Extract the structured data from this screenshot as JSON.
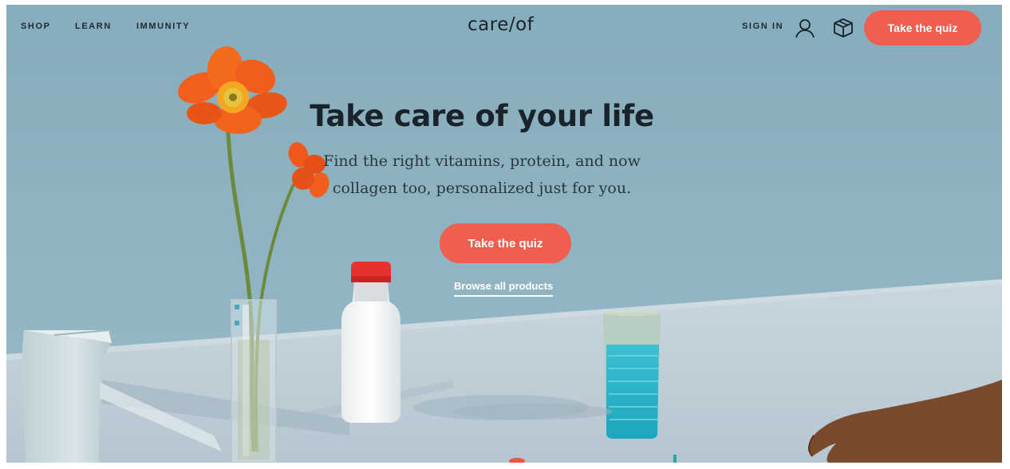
{
  "nav": {
    "links": [
      {
        "label": "SHOP"
      },
      {
        "label": "LEARN"
      },
      {
        "label": "IMMUNITY"
      }
    ],
    "logo": "care/of",
    "signin_label": "SIGN IN",
    "quiz_label": "Take the quiz",
    "icons": [
      "user-icon",
      "box-icon"
    ]
  },
  "hero": {
    "title": "Take care of your life",
    "subtitle_line1": "Find the right vitamins, protein, and now",
    "subtitle_line2": "collagen too, personalized just for you.",
    "cta_label": "Take the quiz",
    "browse_label": "Browse all products"
  },
  "colors": {
    "accent": "#f05e4f",
    "background": "#8db3c2",
    "text": "#1a232b"
  }
}
